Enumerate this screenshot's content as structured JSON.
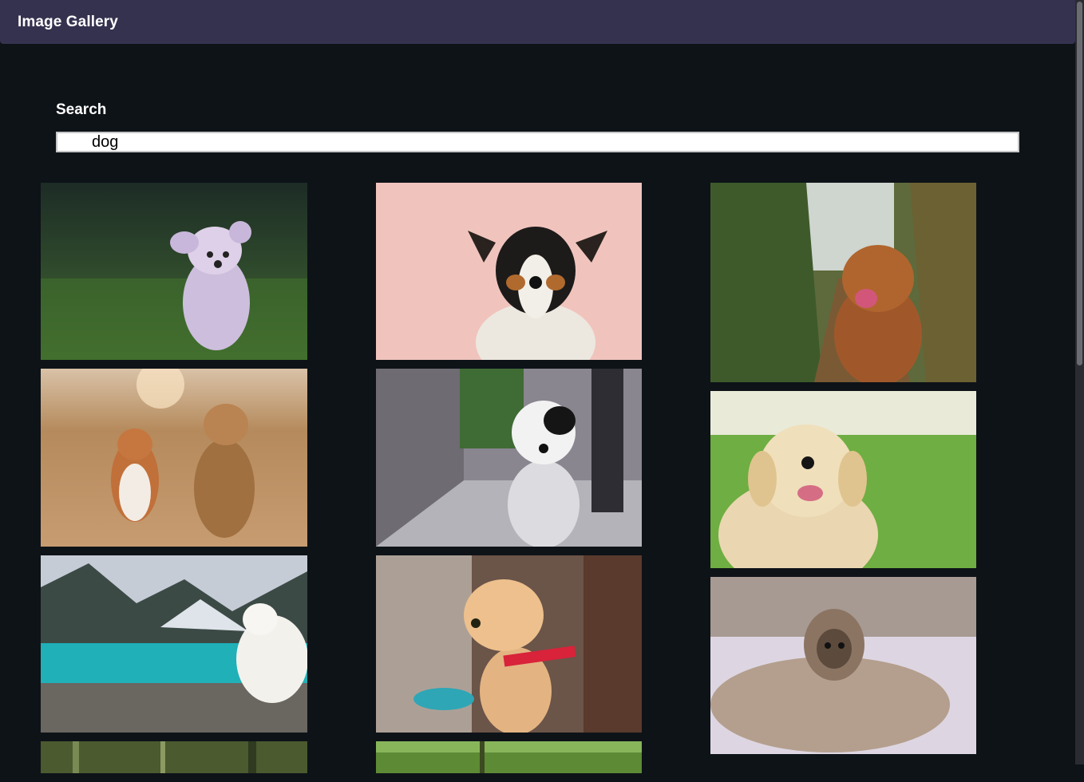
{
  "navbar": {
    "brand": "Image Gallery"
  },
  "search": {
    "label": "Search",
    "value": "dog"
  },
  "gallery": {
    "column_1": [
      {
        "subject": "fluffy white dog running on grass"
      },
      {
        "subject": "corgi and yorkshire terrier on dirt road"
      },
      {
        "subject": "white samoyed by mountain lake"
      },
      {
        "subject": "dog in forest"
      }
    ],
    "column_2": [
      {
        "subject": "jack russell terrier on pink background"
      },
      {
        "subject": "black and white dog on sidewalk"
      },
      {
        "subject": "golden retriever puppy with red collar"
      },
      {
        "subject": "dog on green lawn"
      }
    ],
    "column_3": [
      {
        "subject": "nova scotia duck tolling retriever in tall grass"
      },
      {
        "subject": "golden retriever on green grass"
      },
      {
        "subject": "pug wrapped in blanket on bed"
      }
    ]
  }
}
